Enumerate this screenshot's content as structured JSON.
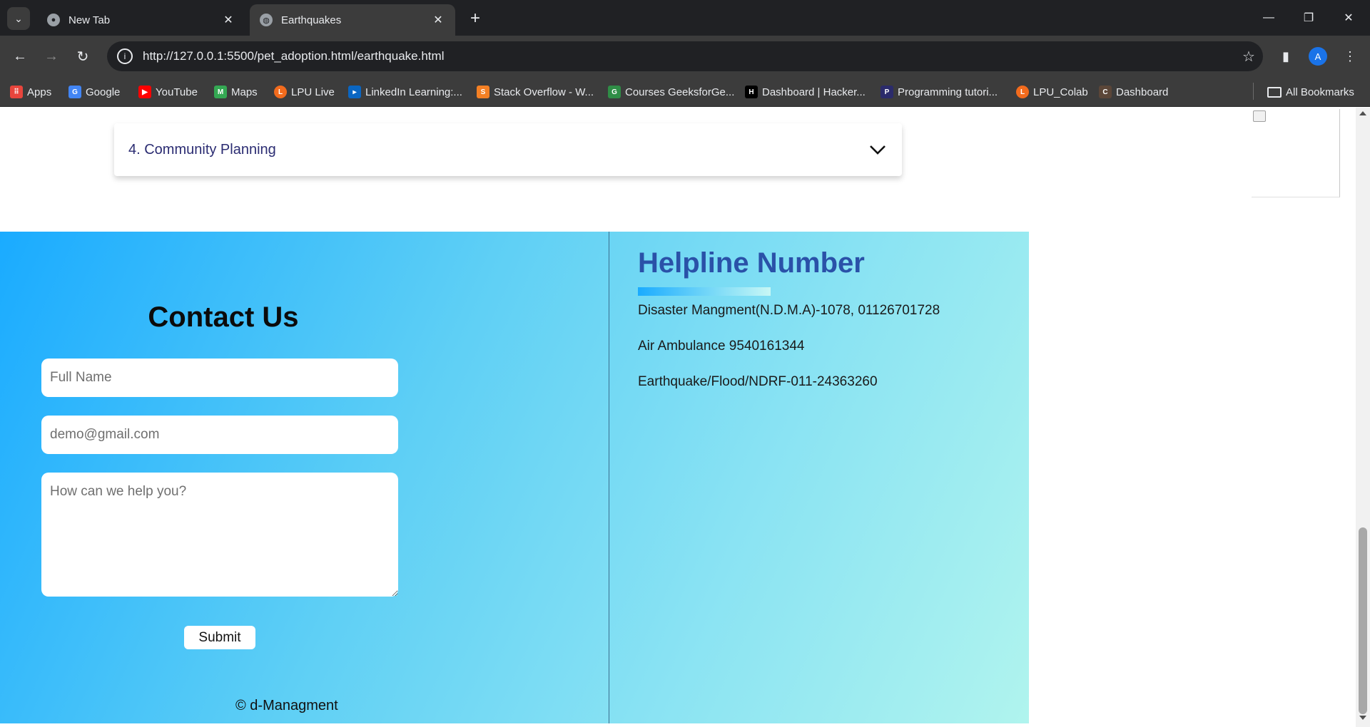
{
  "browser": {
    "tabs": [
      {
        "title": "New Tab",
        "active": false,
        "icon": "chrome-icon"
      },
      {
        "title": "Earthquakes",
        "active": true,
        "icon": "globe-icon"
      }
    ],
    "url": "http://127.0.0.1:5500/pet_adoption.html/earthquake.html",
    "profile_initial": "A",
    "bookmarks": [
      {
        "label": "Apps",
        "icon": "apps-grid-icon",
        "color": "#e8453c"
      },
      {
        "label": "Google",
        "icon": "google-icon",
        "color": "#4285f4"
      },
      {
        "label": "YouTube",
        "icon": "youtube-icon",
        "color": "#ff0000"
      },
      {
        "label": "Maps",
        "icon": "maps-icon",
        "color": "#34a853"
      },
      {
        "label": "LPU Live",
        "icon": "lpu-live-icon",
        "color": "#f26b1d"
      },
      {
        "label": "LinkedIn Learning:...",
        "icon": "linkedin-learning-icon",
        "color": "#0a66c2"
      },
      {
        "label": "Stack Overflow - W...",
        "icon": "stackoverflow-icon",
        "color": "#f48024"
      },
      {
        "label": "Courses GeeksforGe...",
        "icon": "geeksforgeeks-icon",
        "color": "#2f8d46"
      },
      {
        "label": "Dashboard | Hacker...",
        "icon": "hackerrank-icon",
        "color": "#000000"
      },
      {
        "label": "Programming tutori...",
        "icon": "programming-icon",
        "color": "#2b2b6b"
      },
      {
        "label": "LPU_Colab",
        "icon": "lpu-colab-icon",
        "color": "#f26b1d"
      },
      {
        "label": "Dashboard",
        "icon": "codechef-icon",
        "color": "#5b4638"
      }
    ],
    "all_bookmarks": "All Bookmarks"
  },
  "page": {
    "accordion_item": "4. Community Planning",
    "contact": {
      "title": "Contact Us",
      "name_placeholder": "Full Name",
      "email_placeholder": "demo@gmail.com",
      "message_placeholder": "How can we help you?",
      "submit_label": "Submit",
      "copyright": "© d-Managment"
    },
    "helpline": {
      "title": "Helpline Number",
      "lines": [
        "Disaster Mangment(N.D.M.A)-1078, 01126701728",
        "Air Ambulance 9540161344",
        "Earthquake/Flood/NDRF-011-24363260"
      ]
    }
  },
  "colors": {
    "tabbar": "#202124",
    "toolbar": "#3c3c3c",
    "accordion_title": "#2b2c72",
    "helpline_title": "#2a51a8",
    "gradient_start": "#1aabff",
    "gradient_end": "#b0f4ee"
  }
}
